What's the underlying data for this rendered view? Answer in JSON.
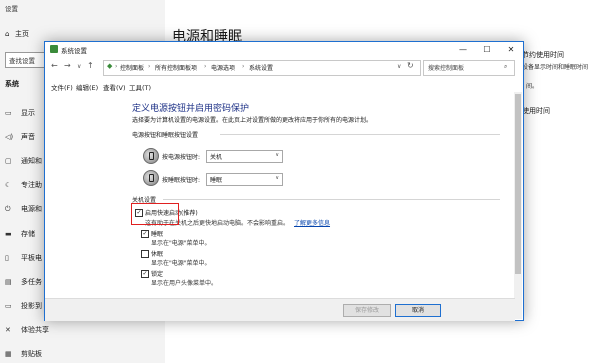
{
  "settings": {
    "app_title": "设置",
    "home": "主页",
    "search_placeholder": "查找设置",
    "section": "系统",
    "nav": [
      "显示",
      "声音",
      "通知和",
      "专注助",
      "电源和",
      "存储",
      "平板电",
      "多任务",
      "投影到",
      "体验共享",
      "剪贴板"
    ],
    "page_title": "电源和睡眠",
    "right_heading": "节约使用时间",
    "right_text1": "设备显示时间和睡眠时间",
    "right_text2": "间。",
    "right_heading2": "使用时间"
  },
  "dialog": {
    "title": "系统设置",
    "breadcrumbs": [
      "控制面板",
      "所有控制面板项",
      "电源选项",
      "系统设置"
    ],
    "search_placeholder": "搜索控制面板",
    "menu": [
      "文件(F)",
      "编辑(E)",
      "查看(V)",
      "工具(T)"
    ],
    "heading": "定义电源按钮并启用密码保护",
    "description": "选择要为计算机设置的电源设置。在此页上对设置所做的更改将应用于你所有的电源计划。",
    "group_buttons": "电源按钮和睡眠按钮设置",
    "power_button_label": "按电源按钮时:",
    "power_button_value": "关机",
    "sleep_button_label": "按睡眠按钮时:",
    "sleep_button_value": "睡眠",
    "group_shutdown": "关机设置",
    "options": [
      {
        "label": "启用快速启动(推荐)",
        "desc": "这有助于在关机之后更快地启动电脑。不会影响重启。",
        "link": "了解更多信息",
        "checked": true
      },
      {
        "label": "睡眠",
        "desc": "显示在\"电源\"菜单中。",
        "checked": true
      },
      {
        "label": "休眠",
        "desc": "显示在\"电源\"菜单中。",
        "checked": false
      },
      {
        "label": "锁定",
        "desc": "显示在用户头像菜单中。",
        "checked": true
      }
    ],
    "save_button": "保存修改",
    "cancel_button": "取消"
  },
  "colors": {
    "accent": "#1e6fd0",
    "heading": "#1e3287",
    "highlight": "#e02020",
    "link": "#0645ad"
  }
}
